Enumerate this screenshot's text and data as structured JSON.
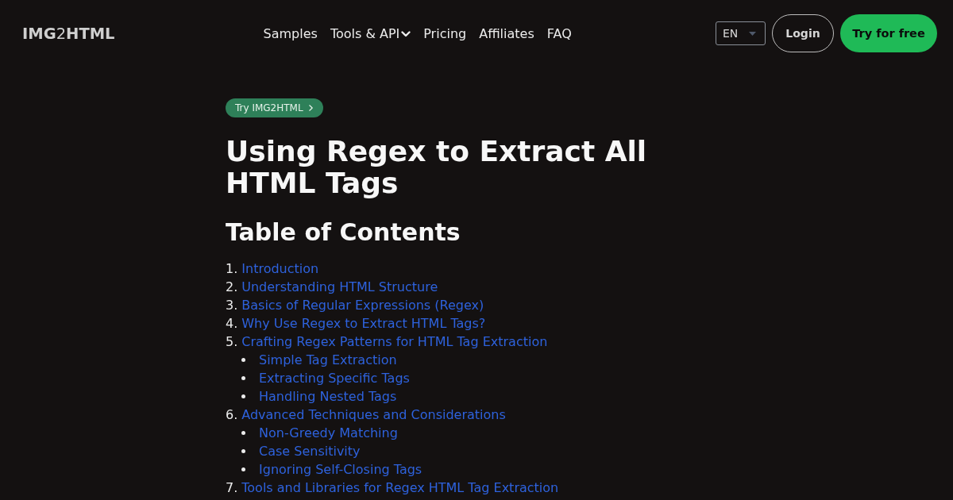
{
  "header": {
    "logo": "**IMG**2**HTML**",
    "nav": [
      {
        "label": "Samples",
        "kind": "link"
      },
      {
        "label": "Tools & API",
        "kind": "dropdown"
      },
      {
        "label": "Pricing",
        "kind": "link"
      },
      {
        "label": "Affiliates",
        "kind": "link"
      },
      {
        "label": "FAQ",
        "kind": "link"
      }
    ],
    "language": "EN",
    "buttons": [
      {
        "label": "Login",
        "kind": "outline"
      },
      {
        "label": "Try for free",
        "kind": "primary"
      }
    ]
  },
  "badge": "Try IMG2HTML",
  "title": "Using Regex to Extract All HTML Tags",
  "toc": {
    "heading": "Table of Contents",
    "items": [
      {
        "number": "1.",
        "label": "Introduction"
      },
      {
        "number": "2.",
        "label": "Understanding HTML Structure"
      },
      {
        "number": "3.",
        "label": "Basics of Regular Expressions (Regex)"
      },
      {
        "number": "4.",
        "label": "Why Use Regex to Extract HTML Tags?"
      },
      {
        "number": "5.",
        "label": "Crafting Regex Patterns for HTML Tag Extraction",
        "children": [
          {
            "label": "Simple Tag Extraction"
          },
          {
            "label": "Extracting Specific Tags"
          },
          {
            "label": "Handling Nested Tags"
          }
        ]
      },
      {
        "number": "6.",
        "label": "Advanced Techniques and Considerations",
        "children": [
          {
            "label": "Non-Greedy Matching"
          },
          {
            "label": "Case Sensitivity"
          },
          {
            "label": "Ignoring Self-Closing Tags"
          }
        ]
      },
      {
        "number": "7.",
        "label": "Tools and Libraries for Regex HTML Tag Extraction"
      }
    ]
  }
}
